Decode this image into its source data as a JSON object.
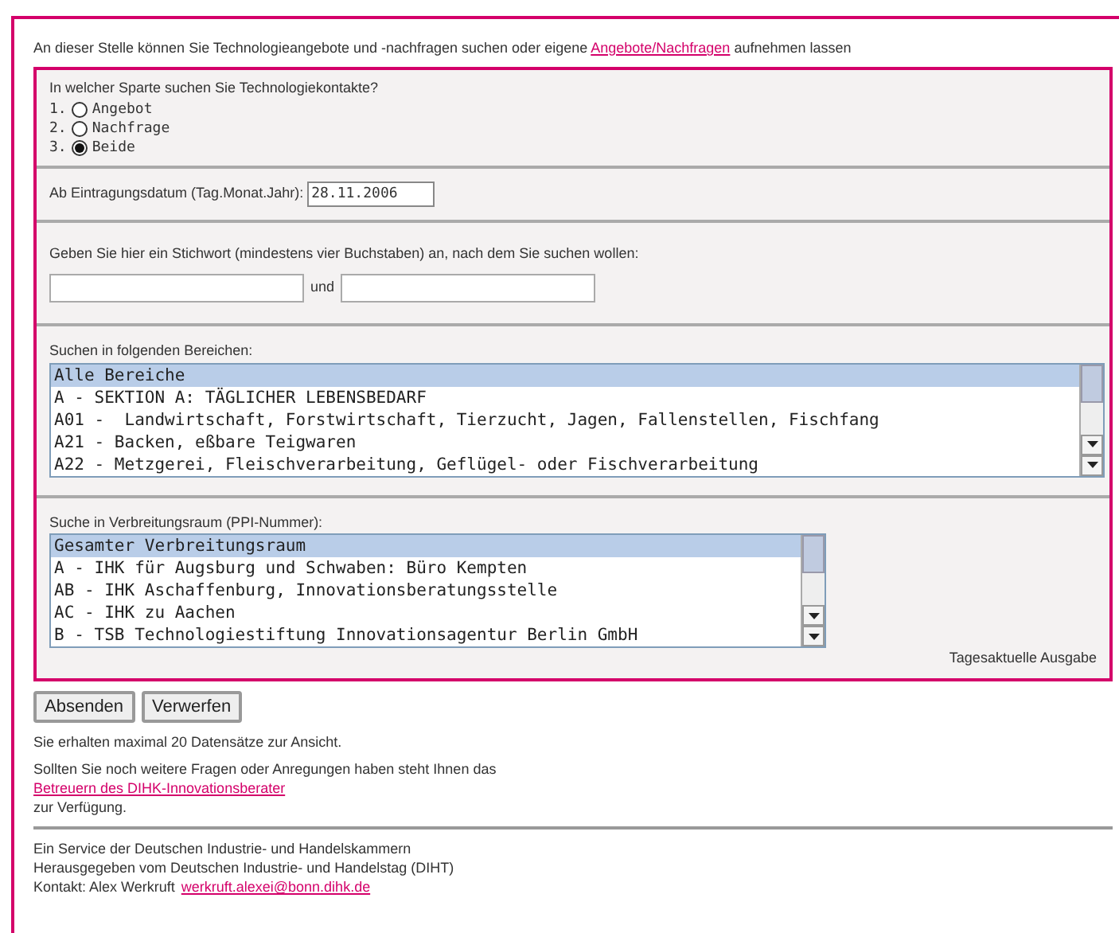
{
  "intro": {
    "text": "An dieser Stelle können Sie Technologieangebote und -nachfragen suchen oder eigene",
    "link": "Angebote/Nachfragen",
    "after": "aufnehmen lassen"
  },
  "sparte": {
    "question": "In welcher Sparte suchen Sie Technologiekontakte?",
    "options": [
      {
        "number": "1.",
        "label": "Angebot",
        "selected": false
      },
      {
        "number": "2.",
        "label": "Nachfrage",
        "selected": false
      },
      {
        "number": "3.",
        "label": "Beide",
        "selected": true
      }
    ]
  },
  "date": {
    "label": "Ab Eintragungsdatum (Tag.Monat.Jahr):",
    "value": "28.11.2006"
  },
  "keyword": {
    "label": "Geben Sie hier ein Stichwort (mindestens vier Buchstaben) an, nach dem Sie suchen wollen:",
    "joiner": "und"
  },
  "bereiche": {
    "label": "Suchen in folgenden Bereichen:",
    "items": [
      {
        "text": "Alle Bereiche",
        "selected": true
      },
      {
        "text": "A - SEKTION A: TÄGLICHER LEBENSBEDARF",
        "selected": false
      },
      {
        "text": "A01 -  Landwirtschaft, Forstwirtschaft, Tierzucht, Jagen, Fallenstellen, Fischfang",
        "selected": false
      },
      {
        "text": "A21 - Backen, eßbare Teigwaren",
        "selected": false
      },
      {
        "text": "A22 - Metzgerei, Fleischverarbeitung, Geflügel- oder Fischverarbeitung",
        "selected": false
      }
    ]
  },
  "raum": {
    "label": "Suche in Verbreitungsraum (PPI-Nummer):",
    "items": [
      {
        "text": "Gesamter Verbreitungsraum",
        "selected": true
      },
      {
        "text": "A - IHK für Augsburg und Schwaben: Büro Kempten",
        "selected": false
      },
      {
        "text": "AB - IHK Aschaffenburg, Innovationsberatungsstelle",
        "selected": false
      },
      {
        "text": "AC - IHK zu Aachen",
        "selected": false
      },
      {
        "text": "B - TSB Technologiestiftung Innovationsagentur Berlin GmbH",
        "selected": false
      }
    ]
  },
  "edition": "Tagesaktuelle Ausgabe",
  "buttons": [
    "Absenden",
    "Verwerfen"
  ],
  "info": "Sie erhalten maximal 20 Datensätze zur Ansicht.",
  "contact": {
    "text": "Sollten Sie noch weitere Fragen oder Anregungen haben steht Ihnen das",
    "link": "Betreuern des DIHK-Innovationsberater",
    "after": "zur Verfügung."
  },
  "footer": {
    "lines": [
      "Ein Service der Deutschen Industrie- und Handelskammern",
      "Herausgegeben vom Deutschen Industrie- und Handelstag (DIHT)"
    ],
    "contact_label": "Kontakt: Alex Werkruft",
    "contact_link": "werkruft.alexei@bonn.dihk.de"
  }
}
